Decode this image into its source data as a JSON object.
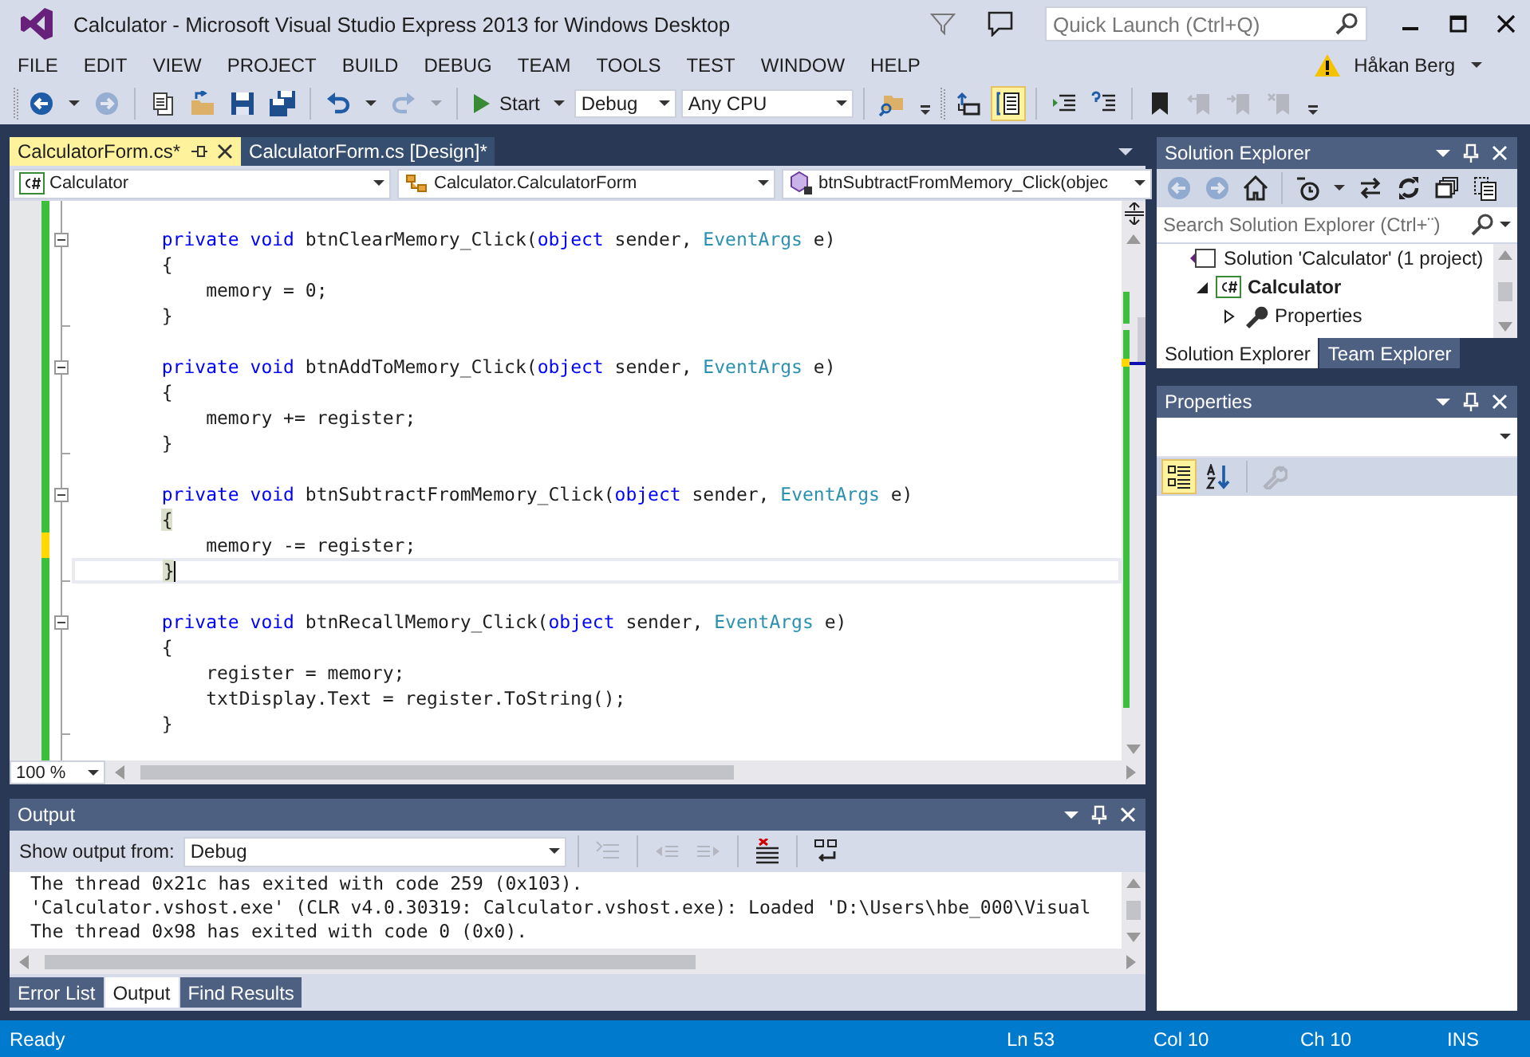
{
  "window": {
    "title": "Calculator - Microsoft Visual Studio Express 2013 for Windows Desktop",
    "quick_launch": {
      "placeholder": "Quick Launch (Ctrl+Q)"
    },
    "user": "Håkan Berg"
  },
  "menu": [
    {
      "label": "FILE"
    },
    {
      "label": "EDIT"
    },
    {
      "label": "VIEW"
    },
    {
      "label": "PROJECT"
    },
    {
      "label": "BUILD"
    },
    {
      "label": "DEBUG"
    },
    {
      "label": "TEAM"
    },
    {
      "label": "TOOLS"
    },
    {
      "label": "TEST"
    },
    {
      "label": "WINDOW"
    },
    {
      "label": "HELP"
    }
  ],
  "toolbars": [
    [
      {
        "kind": "back",
        "disabled": false,
        "selected": false
      },
      {
        "kind": "dropdown",
        "disabled": false,
        "selected": false
      },
      {
        "kind": "forward",
        "disabled": true,
        "selected": false
      },
      {
        "kind": "separator"
      },
      {
        "kind": "new",
        "disabled": false,
        "selected": false
      },
      {
        "kind": "open",
        "disabled": false,
        "selected": false
      },
      {
        "kind": "save",
        "disabled": false,
        "selected": false
      },
      {
        "kind": "saveall",
        "disabled": false,
        "selected": false
      },
      {
        "kind": "separator"
      },
      {
        "kind": "undo",
        "disabled": false,
        "selected": false
      },
      {
        "kind": "dropdown",
        "disabled": false,
        "selected": false
      },
      {
        "kind": "redo",
        "disabled": true,
        "selected": false
      },
      {
        "kind": "dropdown",
        "disabled": true,
        "selected": false
      },
      {
        "kind": "separator"
      },
      {
        "kind": "start",
        "label": "Start"
      },
      {
        "kind": "dropdown",
        "disabled": false,
        "selected": false
      },
      {
        "kind": "combo",
        "value": "Debug"
      },
      {
        "kind": "combo",
        "value": "Any CPU"
      },
      {
        "kind": "separator"
      },
      {
        "kind": "find",
        "disabled": false,
        "selected": false
      },
      {
        "kind": "overflow",
        "disabled": false,
        "selected": false
      }
    ],
    [
      {
        "kind": "navup",
        "disabled": false,
        "selected": false
      },
      {
        "kind": "viewcode",
        "disabled": false,
        "selected": true
      },
      {
        "kind": "separator"
      },
      {
        "kind": "indent",
        "disabled": false,
        "selected": false
      },
      {
        "kind": "comment",
        "disabled": false,
        "selected": false
      },
      {
        "kind": "separator"
      },
      {
        "kind": "bookmark",
        "disabled": false,
        "selected": false
      },
      {
        "kind": "bmprev",
        "disabled": true,
        "selected": false
      },
      {
        "kind": "bmnext",
        "disabled": true,
        "selected": false
      },
      {
        "kind": "bmclear",
        "disabled": true,
        "selected": false
      },
      {
        "kind": "overflow",
        "disabled": false,
        "selected": false
      }
    ]
  ],
  "tabs": [
    {
      "label": "CalculatorForm.cs*",
      "selected": true
    },
    {
      "label": "CalculatorForm.cs [Design]*",
      "selected": false
    }
  ],
  "nav_bar": [
    {
      "kind": "project",
      "value": "Calculator"
    },
    {
      "kind": "class",
      "value": "Calculator.CalculatorForm"
    },
    {
      "kind": "method",
      "value": "btnSubtractFromMemory_Click(objec"
    }
  ],
  "editor": {
    "zoom": "100 %",
    "lines": [
      {
        "unsaved": false,
        "current": false,
        "fold_start": false,
        "fold_end": false
      },
      {
        "unsaved": false,
        "current": false,
        "fold_start": true,
        "fold_end": false,
        "tokens": [
          {
            "kind": "keyword",
            "text": "        private void"
          },
          {
            "kind": "plain",
            "text": " btnClearMemory_Click("
          },
          {
            "kind": "keyword",
            "text": "object"
          },
          {
            "kind": "plain",
            "text": " sender, "
          },
          {
            "kind": "type",
            "text": "EventArgs"
          },
          {
            "kind": "plain",
            "text": " e)"
          }
        ]
      },
      {
        "unsaved": false,
        "current": false,
        "fold_start": false,
        "fold_end": false,
        "tokens": [
          {
            "kind": "plain",
            "text": "        {"
          }
        ]
      },
      {
        "unsaved": false,
        "current": false,
        "fold_start": false,
        "fold_end": false,
        "tokens": [
          {
            "kind": "plain",
            "text": "            memory = 0;"
          }
        ]
      },
      {
        "unsaved": false,
        "current": false,
        "fold_start": false,
        "fold_end": true,
        "tokens": [
          {
            "kind": "plain",
            "text": "        }"
          }
        ]
      },
      {
        "unsaved": false,
        "current": false,
        "fold_start": false,
        "fold_end": false
      },
      {
        "unsaved": false,
        "current": false,
        "fold_start": true,
        "fold_end": false,
        "tokens": [
          {
            "kind": "keyword",
            "text": "        private void"
          },
          {
            "kind": "plain",
            "text": " btnAddToMemory_Click("
          },
          {
            "kind": "keyword",
            "text": "object"
          },
          {
            "kind": "plain",
            "text": " sender, "
          },
          {
            "kind": "type",
            "text": "EventArgs"
          },
          {
            "kind": "plain",
            "text": " e)"
          }
        ]
      },
      {
        "unsaved": false,
        "current": false,
        "fold_start": false,
        "fold_end": false,
        "tokens": [
          {
            "kind": "plain",
            "text": "        {"
          }
        ]
      },
      {
        "unsaved": false,
        "current": false,
        "fold_start": false,
        "fold_end": false,
        "tokens": [
          {
            "kind": "plain",
            "text": "            memory += register;"
          }
        ]
      },
      {
        "unsaved": false,
        "current": false,
        "fold_start": false,
        "fold_end": true,
        "tokens": [
          {
            "kind": "plain",
            "text": "        }"
          }
        ]
      },
      {
        "unsaved": false,
        "current": false,
        "fold_start": false,
        "fold_end": false
      },
      {
        "unsaved": false,
        "current": false,
        "fold_start": true,
        "fold_end": false,
        "tokens": [
          {
            "kind": "keyword",
            "text": "        private void"
          },
          {
            "kind": "plain",
            "text": " btnSubtractFromMemory_Click("
          },
          {
            "kind": "keyword",
            "text": "object"
          },
          {
            "kind": "plain",
            "text": " sender, "
          },
          {
            "kind": "type",
            "text": "EventArgs"
          },
          {
            "kind": "plain",
            "text": " e)"
          }
        ]
      },
      {
        "unsaved": false,
        "current": false,
        "fold_start": false,
        "fold_end": false,
        "tokens": [
          {
            "kind": "brace_match",
            "text": "        {"
          }
        ]
      },
      {
        "unsaved": true,
        "current": false,
        "fold_start": false,
        "fold_end": false,
        "tokens": [
          {
            "kind": "plain",
            "text": "            memory -= register;"
          }
        ]
      },
      {
        "unsaved": false,
        "current": true,
        "fold_start": false,
        "fold_end": true,
        "tokens": [
          {
            "kind": "brace_match",
            "text": "        }"
          }
        ]
      },
      {
        "unsaved": false,
        "current": false,
        "fold_start": false,
        "fold_end": false
      },
      {
        "unsaved": false,
        "current": false,
        "fold_start": true,
        "fold_end": false,
        "tokens": [
          {
            "kind": "keyword",
            "text": "        private void"
          },
          {
            "kind": "plain",
            "text": " btnRecallMemory_Click("
          },
          {
            "kind": "keyword",
            "text": "object"
          },
          {
            "kind": "plain",
            "text": " sender, "
          },
          {
            "kind": "type",
            "text": "EventArgs"
          },
          {
            "kind": "plain",
            "text": " e)"
          }
        ]
      },
      {
        "unsaved": false,
        "current": false,
        "fold_start": false,
        "fold_end": false,
        "tokens": [
          {
            "kind": "plain",
            "text": "        {"
          }
        ]
      },
      {
        "unsaved": false,
        "current": false,
        "fold_start": false,
        "fold_end": false,
        "tokens": [
          {
            "kind": "plain",
            "text": "            register = memory;"
          }
        ]
      },
      {
        "unsaved": false,
        "current": false,
        "fold_start": false,
        "fold_end": false,
        "tokens": [
          {
            "kind": "plain",
            "text": "            txtDisplay.Text = register.ToString();"
          }
        ]
      },
      {
        "unsaved": false,
        "current": false,
        "fold_start": false,
        "fold_end": true,
        "tokens": [
          {
            "kind": "plain",
            "text": "        }"
          }
        ]
      },
      {
        "unsaved": false,
        "current": false,
        "fold_start": false,
        "fold_end": false
      }
    ]
  },
  "output": {
    "title": "Output",
    "source_label": "Show output from:",
    "source": "Debug",
    "tools": [
      {
        "kind": "gotoline",
        "disabled": true
      },
      {
        "kind": "prevline",
        "disabled": true
      },
      {
        "kind": "nextline",
        "disabled": true
      },
      {
        "kind": "clearall",
        "disabled": false
      },
      {
        "kind": "wordwrap",
        "disabled": false
      }
    ],
    "lines": [
      "The thread 0x21c has exited with code 259 (0x103).",
      "'Calculator.vshost.exe' (CLR v4.0.30319: Calculator.vshost.exe): Loaded 'D:\\Users\\hbe_000\\Visual",
      "The thread 0x98 has exited with code 0 (0x0)."
    ],
    "tabs": [
      {
        "label": "Error List",
        "selected": false
      },
      {
        "label": "Output",
        "selected": true
      },
      {
        "label": "Find Results",
        "selected": false
      }
    ]
  },
  "solution_explorer": {
    "title": "Solution Explorer",
    "tools": [
      {
        "kind": "back",
        "disabled": true
      },
      {
        "kind": "forward",
        "disabled": true
      },
      {
        "kind": "home",
        "disabled": false
      },
      {
        "kind": "separator"
      },
      {
        "kind": "history",
        "disabled": false
      },
      {
        "kind": "dropdown",
        "disabled": false
      },
      {
        "kind": "sync",
        "disabled": false
      },
      {
        "kind": "refresh",
        "disabled": false
      },
      {
        "kind": "collapse",
        "disabled": false
      },
      {
        "kind": "showall",
        "disabled": false
      }
    ],
    "search": {
      "placeholder": "Search Solution Explorer (Ctrl+¨)"
    },
    "tree": [
      {
        "kind": "solution",
        "label": "Solution 'Calculator' (1 project)",
        "startup": false,
        "children": [
          {
            "kind": "project",
            "label": "Calculator",
            "startup": true,
            "expanded": true,
            "children": [
              {
                "kind": "properties",
                "label": "Properties",
                "startup": false,
                "expanded": false
              }
            ]
          }
        ]
      }
    ],
    "tabs": [
      {
        "label": "Solution Explorer",
        "selected": true
      },
      {
        "label": "Team Explorer",
        "selected": false
      }
    ]
  },
  "properties": {
    "title": "Properties",
    "tools": [
      {
        "kind": "categorized",
        "disabled": false,
        "selected": true
      },
      {
        "kind": "alphabetical",
        "disabled": false,
        "selected": false
      },
      {
        "kind": "separator"
      },
      {
        "kind": "pages",
        "disabled": true,
        "selected": false
      }
    ]
  },
  "status_bar": {
    "message": "Ready",
    "line": "Ln 53",
    "column": "Col 10",
    "char": "Ch 10",
    "mode": "INS"
  }
}
